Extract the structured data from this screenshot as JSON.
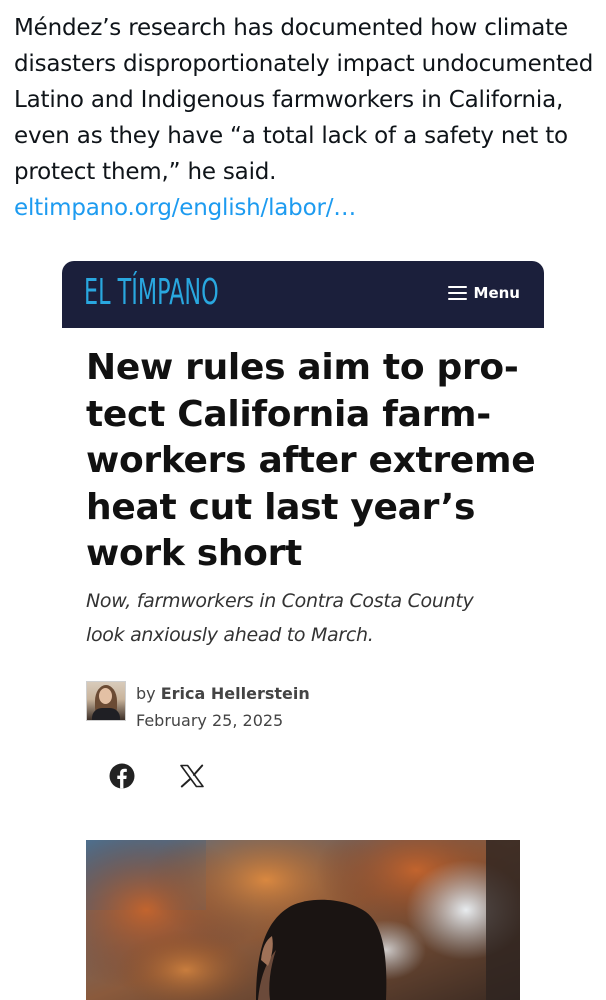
{
  "post": {
    "text": "Méndez’s research has documented how climate disasters disproportionately impact undocumented Latino and Indigenous farmworkers in California, even as they have “a total lack of a safety net to protect them,” he said. ",
    "link": "eltimpano.org/english/labor/…"
  },
  "site": {
    "logo": "EL TÍMPANO",
    "menu_label": "Menu"
  },
  "article": {
    "headline_lines": [
      "New rules aim to pro-",
      "tect California farm-",
      "workers after extreme",
      "heat cut last year’s",
      "work short"
    ],
    "dek_lines": [
      "Now, farmworkers in Contra Costa County",
      "look anxiously ahead to March."
    ],
    "byline_prefix": "by",
    "author": "Erica Hellerstein",
    "date": "February 25, 2025"
  },
  "share": {
    "icons": [
      "facebook-icon",
      "x-icon"
    ]
  },
  "colors": {
    "header_bg": "#1b1f3b",
    "logo": "#29a7df",
    "link": "#1d9bf0"
  }
}
